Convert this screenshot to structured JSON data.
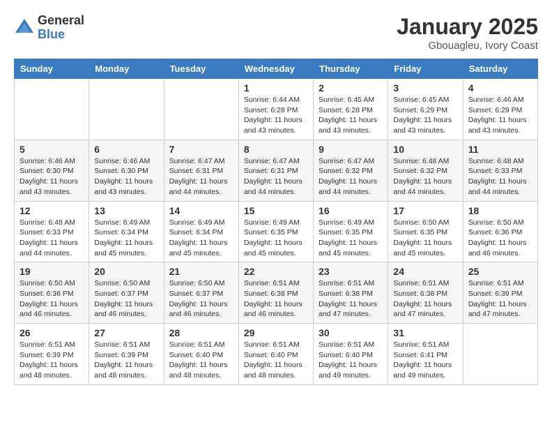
{
  "logo": {
    "general": "General",
    "blue": "Blue"
  },
  "header": {
    "month": "January 2025",
    "location": "Gbouagleu, Ivory Coast"
  },
  "weekdays": [
    "Sunday",
    "Monday",
    "Tuesday",
    "Wednesday",
    "Thursday",
    "Friday",
    "Saturday"
  ],
  "weeks": [
    [
      {
        "day": "",
        "info": ""
      },
      {
        "day": "",
        "info": ""
      },
      {
        "day": "",
        "info": ""
      },
      {
        "day": "1",
        "info": "Sunrise: 6:44 AM\nSunset: 6:28 PM\nDaylight: 11 hours\nand 43 minutes."
      },
      {
        "day": "2",
        "info": "Sunrise: 6:45 AM\nSunset: 6:28 PM\nDaylight: 11 hours\nand 43 minutes."
      },
      {
        "day": "3",
        "info": "Sunrise: 6:45 AM\nSunset: 6:29 PM\nDaylight: 11 hours\nand 43 minutes."
      },
      {
        "day": "4",
        "info": "Sunrise: 6:46 AM\nSunset: 6:29 PM\nDaylight: 11 hours\nand 43 minutes."
      }
    ],
    [
      {
        "day": "5",
        "info": "Sunrise: 6:46 AM\nSunset: 6:30 PM\nDaylight: 11 hours\nand 43 minutes."
      },
      {
        "day": "6",
        "info": "Sunrise: 6:46 AM\nSunset: 6:30 PM\nDaylight: 11 hours\nand 43 minutes."
      },
      {
        "day": "7",
        "info": "Sunrise: 6:47 AM\nSunset: 6:31 PM\nDaylight: 11 hours\nand 44 minutes."
      },
      {
        "day": "8",
        "info": "Sunrise: 6:47 AM\nSunset: 6:31 PM\nDaylight: 11 hours\nand 44 minutes."
      },
      {
        "day": "9",
        "info": "Sunrise: 6:47 AM\nSunset: 6:32 PM\nDaylight: 11 hours\nand 44 minutes."
      },
      {
        "day": "10",
        "info": "Sunrise: 6:48 AM\nSunset: 6:32 PM\nDaylight: 11 hours\nand 44 minutes."
      },
      {
        "day": "11",
        "info": "Sunrise: 6:48 AM\nSunset: 6:33 PM\nDaylight: 11 hours\nand 44 minutes."
      }
    ],
    [
      {
        "day": "12",
        "info": "Sunrise: 6:48 AM\nSunset: 6:33 PM\nDaylight: 11 hours\nand 44 minutes."
      },
      {
        "day": "13",
        "info": "Sunrise: 6:49 AM\nSunset: 6:34 PM\nDaylight: 11 hours\nand 45 minutes."
      },
      {
        "day": "14",
        "info": "Sunrise: 6:49 AM\nSunset: 6:34 PM\nDaylight: 11 hours\nand 45 minutes."
      },
      {
        "day": "15",
        "info": "Sunrise: 6:49 AM\nSunset: 6:35 PM\nDaylight: 11 hours\nand 45 minutes."
      },
      {
        "day": "16",
        "info": "Sunrise: 6:49 AM\nSunset: 6:35 PM\nDaylight: 11 hours\nand 45 minutes."
      },
      {
        "day": "17",
        "info": "Sunrise: 6:50 AM\nSunset: 6:35 PM\nDaylight: 11 hours\nand 45 minutes."
      },
      {
        "day": "18",
        "info": "Sunrise: 6:50 AM\nSunset: 6:36 PM\nDaylight: 11 hours\nand 46 minutes."
      }
    ],
    [
      {
        "day": "19",
        "info": "Sunrise: 6:50 AM\nSunset: 6:36 PM\nDaylight: 11 hours\nand 46 minutes."
      },
      {
        "day": "20",
        "info": "Sunrise: 6:50 AM\nSunset: 6:37 PM\nDaylight: 11 hours\nand 46 minutes."
      },
      {
        "day": "21",
        "info": "Sunrise: 6:50 AM\nSunset: 6:37 PM\nDaylight: 11 hours\nand 46 minutes."
      },
      {
        "day": "22",
        "info": "Sunrise: 6:51 AM\nSunset: 6:38 PM\nDaylight: 11 hours\nand 46 minutes."
      },
      {
        "day": "23",
        "info": "Sunrise: 6:51 AM\nSunset: 6:38 PM\nDaylight: 11 hours\nand 47 minutes."
      },
      {
        "day": "24",
        "info": "Sunrise: 6:51 AM\nSunset: 6:38 PM\nDaylight: 11 hours\nand 47 minutes."
      },
      {
        "day": "25",
        "info": "Sunrise: 6:51 AM\nSunset: 6:39 PM\nDaylight: 11 hours\nand 47 minutes."
      }
    ],
    [
      {
        "day": "26",
        "info": "Sunrise: 6:51 AM\nSunset: 6:39 PM\nDaylight: 11 hours\nand 48 minutes."
      },
      {
        "day": "27",
        "info": "Sunrise: 6:51 AM\nSunset: 6:39 PM\nDaylight: 11 hours\nand 48 minutes."
      },
      {
        "day": "28",
        "info": "Sunrise: 6:51 AM\nSunset: 6:40 PM\nDaylight: 11 hours\nand 48 minutes."
      },
      {
        "day": "29",
        "info": "Sunrise: 6:51 AM\nSunset: 6:40 PM\nDaylight: 11 hours\nand 48 minutes."
      },
      {
        "day": "30",
        "info": "Sunrise: 6:51 AM\nSunset: 6:40 PM\nDaylight: 11 hours\nand 49 minutes."
      },
      {
        "day": "31",
        "info": "Sunrise: 6:51 AM\nSunset: 6:41 PM\nDaylight: 11 hours\nand 49 minutes."
      },
      {
        "day": "",
        "info": ""
      }
    ]
  ]
}
